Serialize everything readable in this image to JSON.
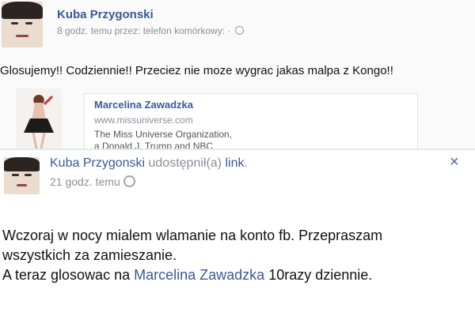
{
  "top_post": {
    "author": "Kuba Przygonski",
    "meta": "8 godz. temu przez: telefon komórkowy: · ",
    "text": "Glosujemy!! Codziennie!! Przeciez nie moze wygrac jakas malpa z Kongo!!",
    "shared": {
      "title": "Marcelina Zawadzka",
      "url": "www.missuniverse.com",
      "description": "The Miss Universe Organization, a Donald J. Trump and NBC Universal joint venture is a global"
    }
  },
  "second_post": {
    "author": "Kuba Przygonski",
    "action": " udostępnił(a) ",
    "link": "link",
    "period": ".",
    "time": "21 godz. temu",
    "text_line1": "Wczoraj w nocy mialem wlamanie na konto fb. Przepraszam",
    "text_line2": "wszystkich za zamieszanie.",
    "text_line3_pre": "A teraz glosowac na ",
    "text_line3_link": "Marcelina Zawadzka",
    "text_line3_post": " 10razy dziennie.",
    "close_symbol": "×"
  },
  "colors": {
    "link": "#3b5998",
    "muted": "#8a8f99"
  },
  "icons": [
    "globe-icon",
    "close-icon",
    "avatar"
  ]
}
